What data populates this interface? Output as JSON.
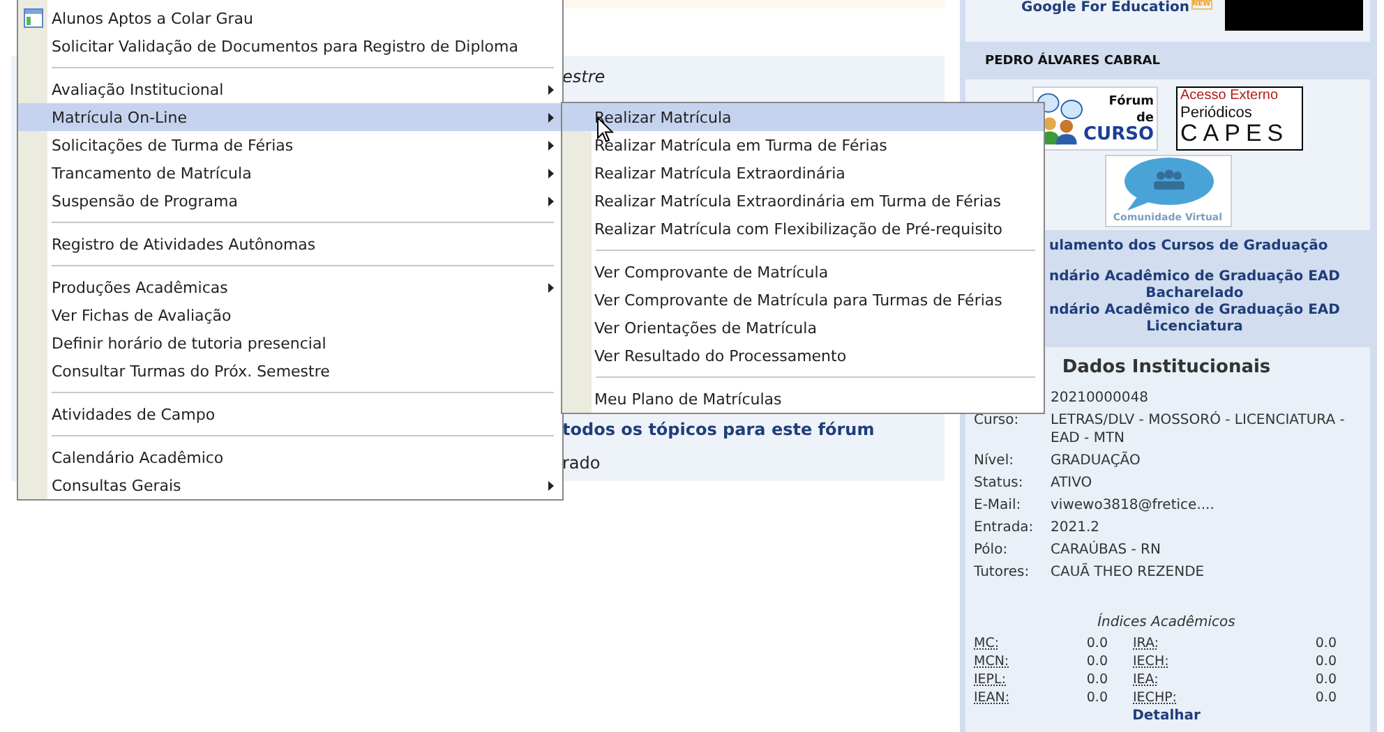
{
  "page": {
    "section_fragment": "estre",
    "forum_link": "todos os tópicos para este fórum",
    "status_fragment": "rado"
  },
  "sidebar": {
    "google_link": "Google For Education",
    "new_badge": "NEW",
    "user_name": "PEDRO ÁLVARES CABRAL",
    "logos": [
      {
        "kind": "forum",
        "lines": [
          "Fórum",
          "de",
          "CURSO"
        ]
      },
      {
        "kind": "capes",
        "lines": [
          "Acesso Externo",
          "Periódicos",
          "CAPES"
        ]
      },
      {
        "kind": "community",
        "lines": [
          "Comunidade Virtual"
        ]
      }
    ],
    "links": [
      {
        "lines": [
          "ulamento dos Cursos de Graduação"
        ]
      },
      {
        "lines": [
          "ndário Acadêmico de Graduação EAD",
          "Bacharelado"
        ]
      },
      {
        "lines": [
          "ndário Acadêmico de Graduação EAD",
          "Licenciatura"
        ]
      }
    ],
    "institutional": {
      "title": "Dados Institucionais",
      "fields": [
        {
          "value": "20210000048"
        },
        {
          "label": "Curso:",
          "value": "LETRAS/DLV - MOSSORÓ - LICENCIATURA - EAD - MTN"
        },
        {
          "label": "Nível:",
          "value": "GRADUAÇÃO"
        },
        {
          "label": "Status:",
          "value": "ATIVO"
        },
        {
          "label": "E-Mail:",
          "value": "viwewo3818@fretice...."
        },
        {
          "label": "Entrada:",
          "value": "2021.2"
        },
        {
          "label": "Pólo:",
          "value": "CARAÚBAS - RN"
        },
        {
          "label": "Tutores:",
          "value": "CAUÃ THEO REZENDE"
        }
      ],
      "indices_title": "Índices Acadêmicos",
      "indices": [
        {
          "label": "MC:",
          "value": "0.0"
        },
        {
          "label": "IRA:",
          "value": "0.0"
        },
        {
          "label": "MCN:",
          "value": "0.0"
        },
        {
          "label": "IECH:",
          "value": "0.0"
        },
        {
          "label": "IEPL:",
          "value": "0.0"
        },
        {
          "label": "IEA:",
          "value": "0.0"
        },
        {
          "label": "IEAN:",
          "value": "0.0"
        },
        {
          "label": "IECHP:",
          "value": "0.0"
        }
      ],
      "details_link": "Detalhar"
    }
  },
  "menu": {
    "items": [
      {
        "kind": "item",
        "label": "Alunos Aptos a Colar Grau",
        "has_icon": true,
        "submenu": false,
        "selected": false
      },
      {
        "kind": "item",
        "label": "Solicitar Validação de Documentos para Registro de Diploma",
        "has_icon": false,
        "submenu": false,
        "selected": false
      },
      {
        "kind": "separator"
      },
      {
        "kind": "item",
        "label": "Avaliação Institucional",
        "has_icon": false,
        "submenu": true,
        "selected": false
      },
      {
        "kind": "item",
        "label": "Matrícula On-Line",
        "has_icon": false,
        "submenu": true,
        "selected": true
      },
      {
        "kind": "item",
        "label": "Solicitações de Turma de Férias",
        "has_icon": false,
        "submenu": true,
        "selected": false
      },
      {
        "kind": "item",
        "label": "Trancamento de Matrícula",
        "has_icon": false,
        "submenu": true,
        "selected": false
      },
      {
        "kind": "item",
        "label": "Suspensão de Programa",
        "has_icon": false,
        "submenu": true,
        "selected": false
      },
      {
        "kind": "separator"
      },
      {
        "kind": "item",
        "label": "Registro de Atividades Autônomas",
        "has_icon": false,
        "submenu": false,
        "selected": false
      },
      {
        "kind": "separator"
      },
      {
        "kind": "item",
        "label": "Produções Acadêmicas",
        "has_icon": false,
        "submenu": true,
        "selected": false
      },
      {
        "kind": "item",
        "label": "Ver Fichas de Avaliação",
        "has_icon": false,
        "submenu": false,
        "selected": false
      },
      {
        "kind": "item",
        "label": "Definir horário de tutoria presencial",
        "has_icon": false,
        "submenu": false,
        "selected": false
      },
      {
        "kind": "item",
        "label": "Consultar Turmas do Próx. Semestre",
        "has_icon": false,
        "submenu": false,
        "selected": false
      },
      {
        "kind": "separator"
      },
      {
        "kind": "item",
        "label": "Atividades de Campo",
        "has_icon": false,
        "submenu": false,
        "selected": false
      },
      {
        "kind": "separator"
      },
      {
        "kind": "item",
        "label": "Calendário Acadêmico",
        "has_icon": false,
        "submenu": false,
        "selected": false
      },
      {
        "kind": "item",
        "label": "Consultas Gerais",
        "has_icon": false,
        "submenu": true,
        "selected": false
      }
    ]
  },
  "submenu": {
    "items": [
      {
        "kind": "item",
        "label": "Realizar Matrícula",
        "selected": true
      },
      {
        "kind": "item",
        "label": "Realizar Matrícula em Turma de Férias",
        "selected": false
      },
      {
        "kind": "item",
        "label": "Realizar Matrícula Extraordinária",
        "selected": false
      },
      {
        "kind": "item",
        "label": "Realizar Matrícula Extraordinária em Turma de Férias",
        "selected": false
      },
      {
        "kind": "item",
        "label": "Realizar Matrícula com Flexibilização de Pré-requisito",
        "selected": false
      },
      {
        "kind": "separator"
      },
      {
        "kind": "item",
        "label": "Ver Comprovante de Matrícula",
        "selected": false
      },
      {
        "kind": "item",
        "label": "Ver Comprovante de Matrícula para Turmas de Férias",
        "selected": false
      },
      {
        "kind": "item",
        "label": "Ver Orientações de Matrícula",
        "selected": false
      },
      {
        "kind": "item",
        "label": "Ver Resultado do Processamento",
        "selected": false
      },
      {
        "kind": "separator"
      },
      {
        "kind": "item",
        "label": "Meu Plano de Matrículas",
        "selected": false
      }
    ]
  }
}
